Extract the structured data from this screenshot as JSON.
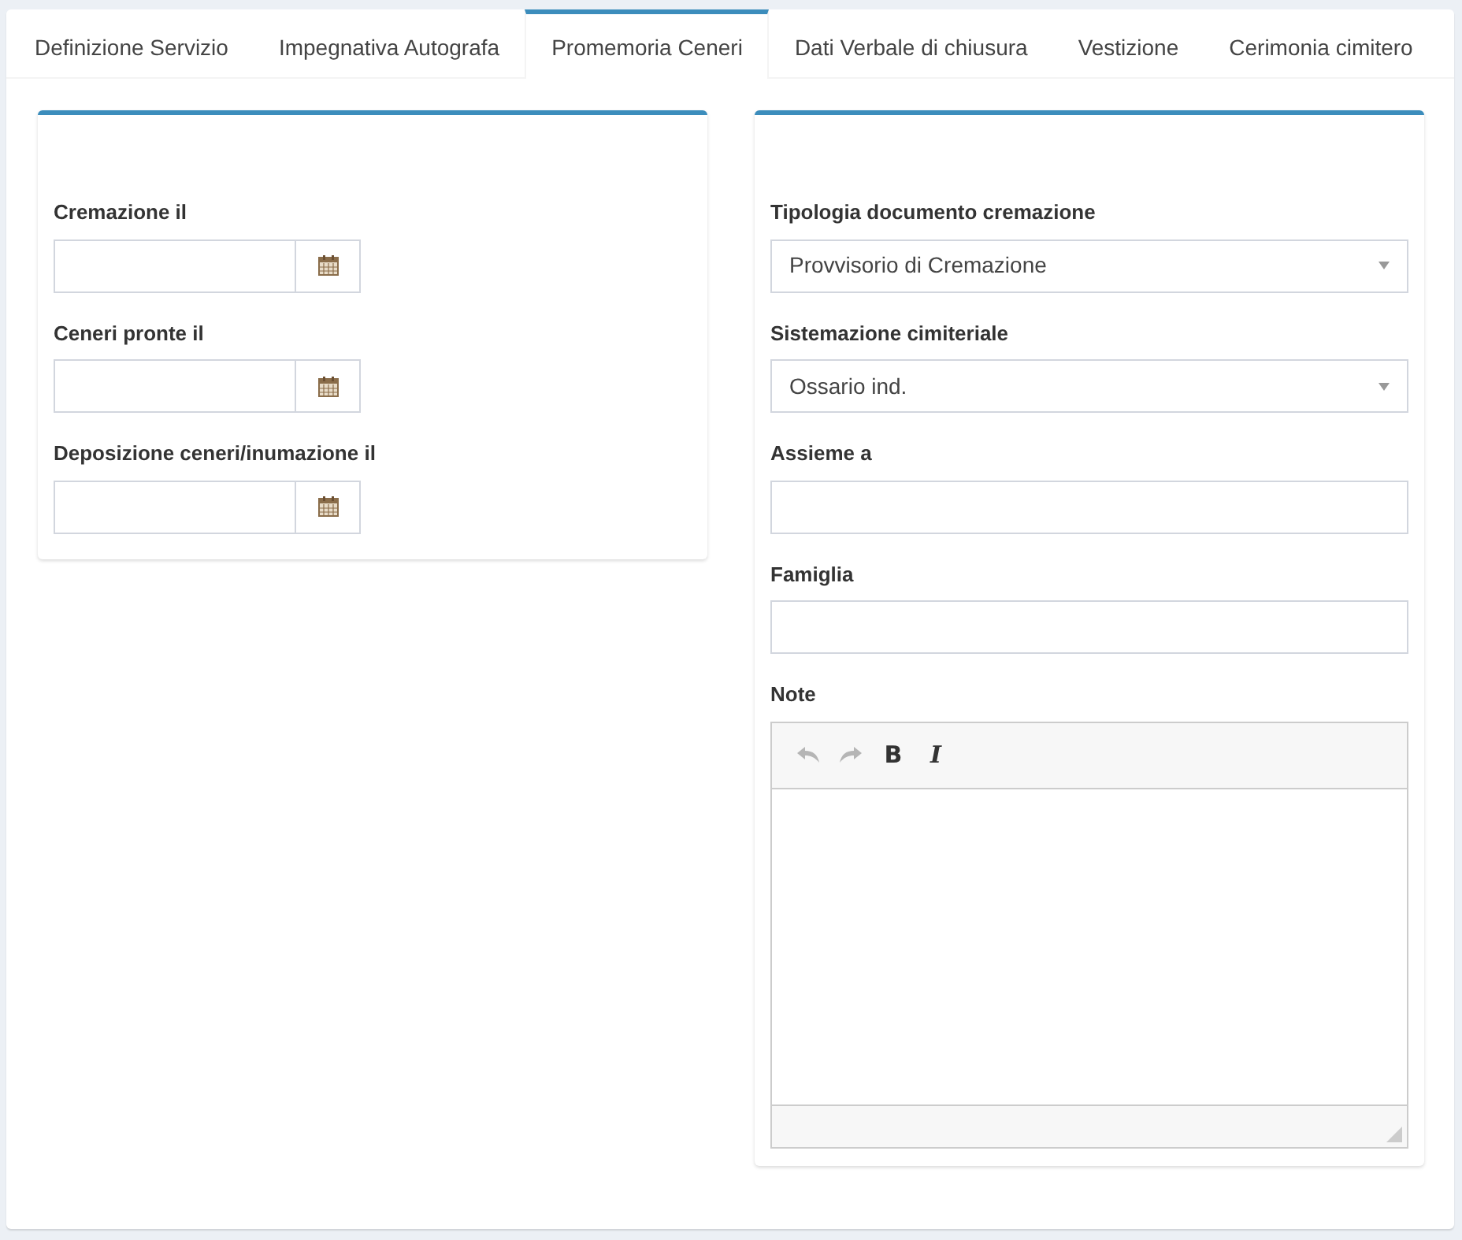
{
  "tabs": [
    {
      "label": "Definizione Servizio",
      "selected": false
    },
    {
      "label": "Impegnativa Autografa",
      "selected": false
    },
    {
      "label": "Promemoria Ceneri",
      "selected": true
    },
    {
      "label": "Dati Verbale di chiusura",
      "selected": false
    },
    {
      "label": "Vestizione",
      "selected": false
    },
    {
      "label": "Cerimonia cimitero",
      "selected": false
    }
  ],
  "left_panel": {
    "fields": [
      {
        "label": "Cremazione il"
      },
      {
        "label": "Ceneri pronte il"
      },
      {
        "label": "Deposizione ceneri/inumazione il"
      }
    ]
  },
  "right_panel": {
    "fields": [
      {
        "kind": "select",
        "label": "Tipologia documento cremazione",
        "value": "Provvisorio di Cremazione"
      },
      {
        "kind": "select",
        "label": "Sistemazione cimiteriale",
        "value": "Ossario ind."
      },
      {
        "kind": "text",
        "label": "Assieme a"
      },
      {
        "kind": "text",
        "label": "Famiglia"
      }
    ],
    "note": {
      "label": "Note",
      "toolbar": [
        {
          "kind": "undo",
          "disabled": true
        },
        {
          "kind": "redo",
          "disabled": true
        },
        {
          "kind": "bold",
          "label": "B",
          "disabled": false
        },
        {
          "kind": "italic",
          "label": "I",
          "disabled": false
        }
      ]
    }
  }
}
